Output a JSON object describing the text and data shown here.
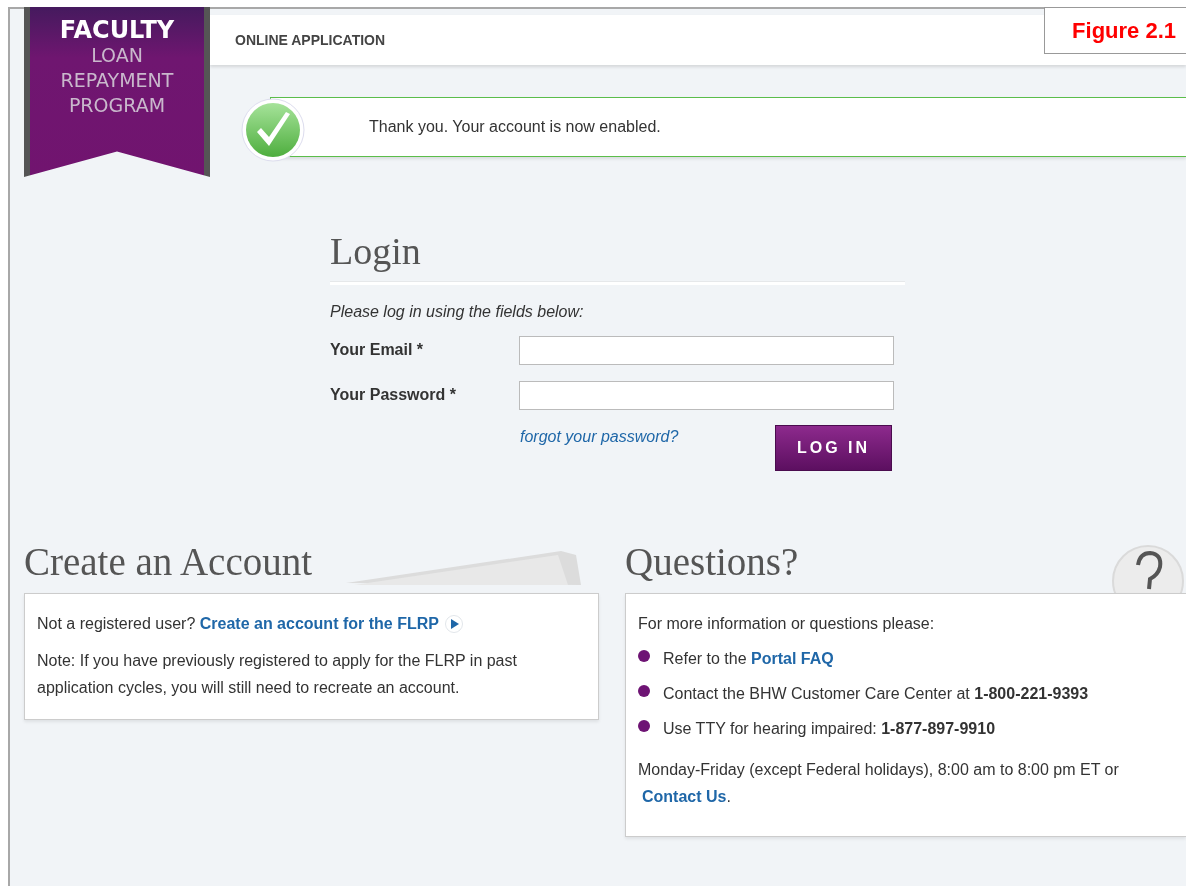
{
  "logo": {
    "lines": [
      {
        "text": "FACULTY",
        "kind": "strong"
      },
      {
        "text": "LOAN",
        "kind": "light"
      },
      {
        "text": "REPAYMENT",
        "kind": "light"
      },
      {
        "text": "PROGRAM",
        "kind": "light"
      }
    ]
  },
  "header": {
    "title": "ONLINE APPLICATION"
  },
  "figure_label": "Figure 2.1",
  "success_banner": {
    "message": "Thank you. Your account is now enabled."
  },
  "login": {
    "title": "Login",
    "instruction": "Please log in using the fields below:",
    "fields": [
      {
        "label": "Your Email *"
      },
      {
        "label": "Your Password *"
      }
    ],
    "forgot_link": "forgot your password?",
    "button": "LOG IN"
  },
  "create_account": {
    "title": "Create an Account",
    "prompt": "Not a registered user?",
    "link": "Create an account for the FLRP",
    "note": "Note: If you have previously registered to apply for the FLRP in past application cycles, you will still need to recreate an account."
  },
  "questions": {
    "title": "Questions?",
    "intro": "For more information or questions please:",
    "items": [
      {
        "text": "Refer to the ",
        "link": "Portal FAQ"
      },
      {
        "text": "Contact the BHW Customer Care Center at **1-800-221-9393**"
      },
      {
        "text": "Use TTY for hearing impaired: **1-877-897-9910**"
      }
    ],
    "hours": "Monday-Friday (except Federal holidays), 8:00 am to 8:00 pm ET or",
    "contact_link": "Contact Us",
    "hours_end": "."
  }
}
